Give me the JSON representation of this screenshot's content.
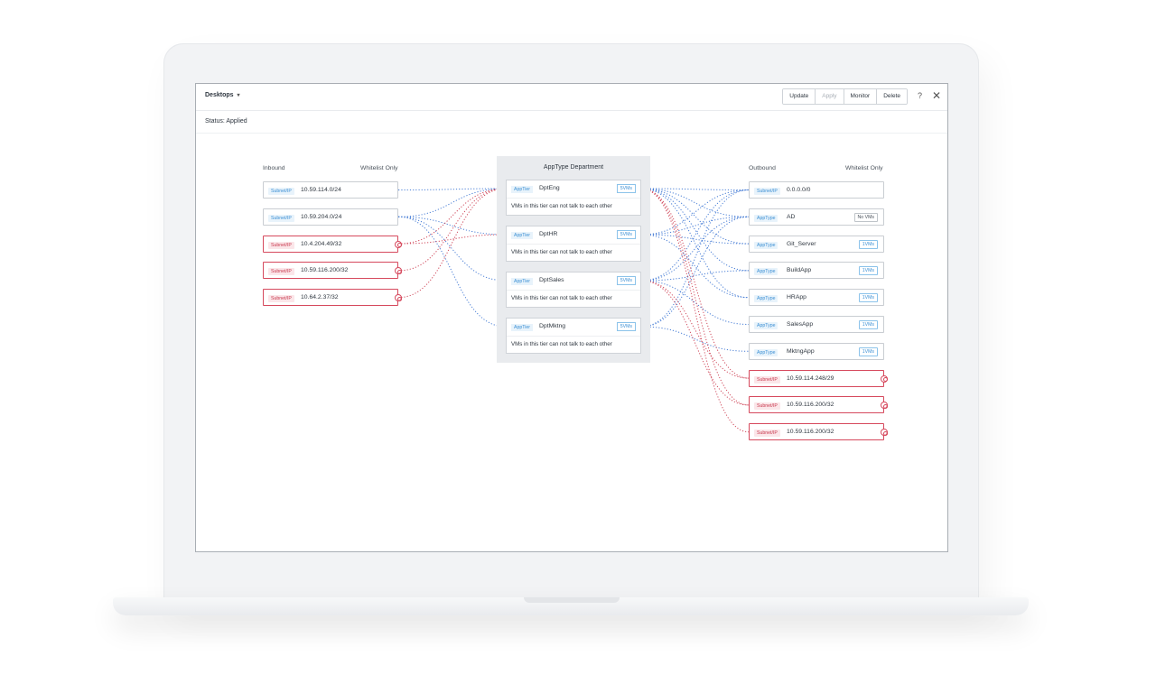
{
  "header": {
    "title": "Desktops",
    "buttons": {
      "update": "Update",
      "apply": "Apply",
      "monitor": "Monitor",
      "delete": "Delete"
    },
    "help": "?",
    "close": "✕"
  },
  "status": "Status: Applied",
  "inbound": {
    "heading": "Inbound",
    "whitelist": "Whitelist Only",
    "items": [
      {
        "tag": "Subnet/IP",
        "label": "10.59.114.0/24",
        "status": "normal"
      },
      {
        "tag": "Subnet/IP",
        "label": "10.59.204.0/24",
        "status": "normal"
      },
      {
        "tag": "Subnet/IP",
        "label": "10.4.204.49/32",
        "status": "removed"
      },
      {
        "tag": "Subnet/IP",
        "label": "10.59.116.200/32",
        "status": "removed"
      },
      {
        "tag": "Subnet/IP",
        "label": "10.64.2.37/32",
        "status": "removed"
      }
    ]
  },
  "department": {
    "title": "AppType Department",
    "tiers": [
      {
        "tag": "AppTier",
        "name": "DptEng",
        "vms": "5VMs",
        "desc": "VMs in this tier can not talk to each other"
      },
      {
        "tag": "AppTier",
        "name": "DptHR",
        "vms": "5VMs",
        "desc": "VMs in this tier can not talk to each other"
      },
      {
        "tag": "AppTier",
        "name": "DptSales",
        "vms": "5VMs",
        "desc": "VMs in this tier can not talk to each other"
      },
      {
        "tag": "AppTier",
        "name": "DptMktng",
        "vms": "5VMs",
        "desc": "VMs in this tier can not talk to each other"
      }
    ]
  },
  "outbound": {
    "heading": "Outbound",
    "whitelist": "Whitelist Only",
    "items": [
      {
        "tag": "Subnet/IP",
        "label": "0.0.0.0/0",
        "pill": "",
        "status": "normal"
      },
      {
        "tag": "AppType",
        "label": "AD",
        "pill": "No VMs",
        "status": "normal"
      },
      {
        "tag": "AppType",
        "label": "Git_Server",
        "pill": "1VMs",
        "status": "normal"
      },
      {
        "tag": "AppType",
        "label": "BuildApp",
        "pill": "1VMs",
        "status": "normal"
      },
      {
        "tag": "AppType",
        "label": "HRApp",
        "pill": "1VMs",
        "status": "normal"
      },
      {
        "tag": "AppType",
        "label": "SalesApp",
        "pill": "1VMs",
        "status": "normal"
      },
      {
        "tag": "AppType",
        "label": "MktngApp",
        "pill": "1VMs",
        "status": "normal"
      },
      {
        "tag": "Subnet/IP",
        "label": "10.59.114.248/29",
        "pill": "",
        "status": "removed"
      },
      {
        "tag": "Subnet/IP",
        "label": "10.59.116.200/32",
        "pill": "",
        "status": "removed"
      },
      {
        "tag": "Subnet/IP",
        "label": "10.59.116.200/32",
        "pill": "",
        "status": "removed"
      }
    ]
  },
  "colors": {
    "allowed_link": "#4a7fd6",
    "removed_link": "#d04a5c",
    "accent": "#3b8fd4"
  }
}
